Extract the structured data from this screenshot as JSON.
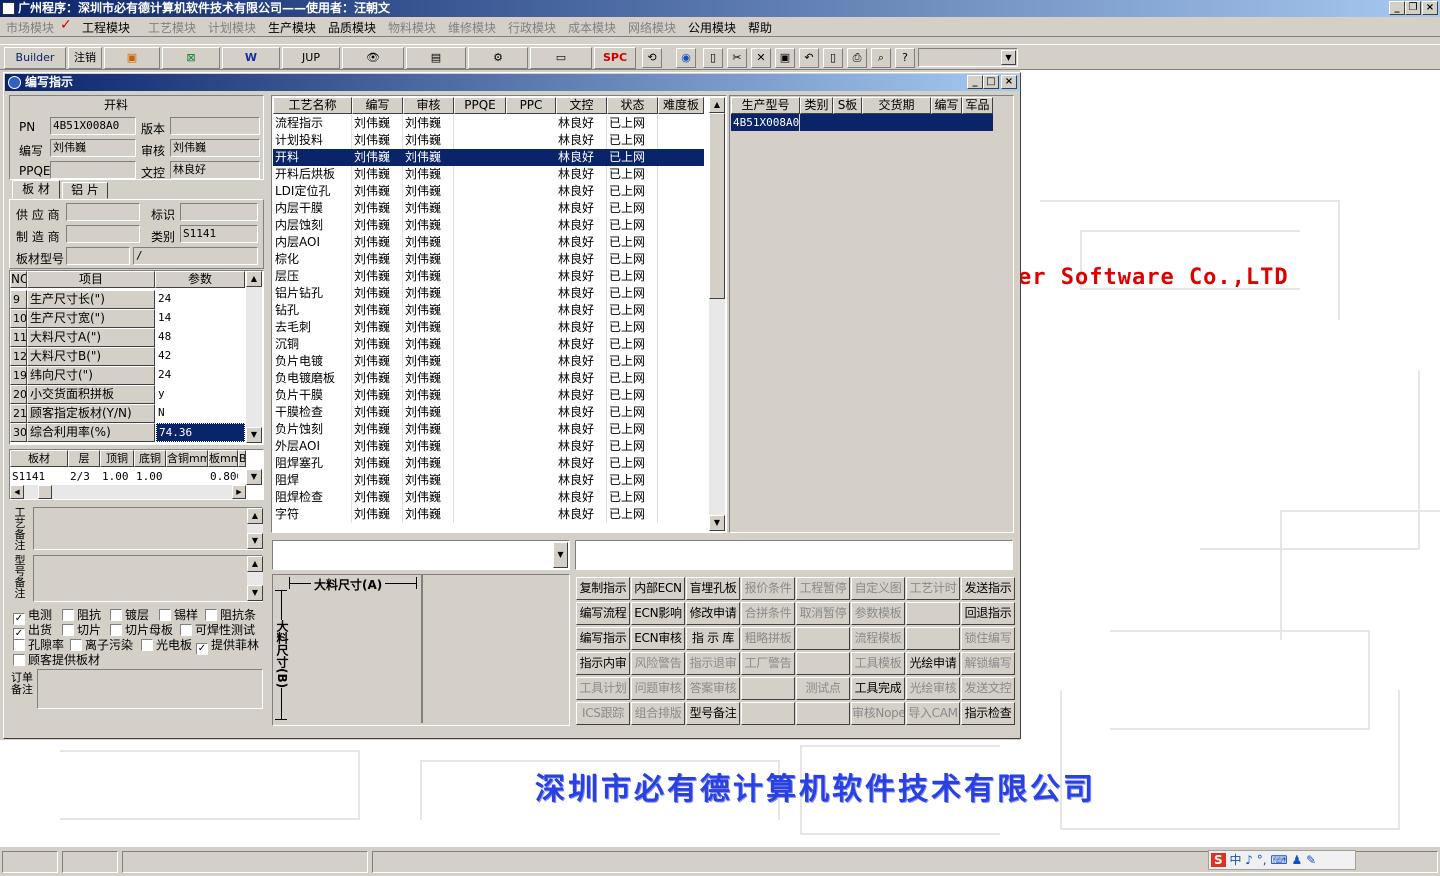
{
  "app": {
    "title": "广州程序：深圳市必有德计算机软件技术有限公司——使用者：汪朝文"
  },
  "menu": [
    {
      "label": "市场模块",
      "enabled": false
    },
    {
      "label": "✓",
      "enabled": true,
      "is_mark": true
    },
    {
      "label": "工程模块",
      "enabled": true
    },
    {
      "label": "工艺模块",
      "enabled": false
    },
    {
      "label": "计划模块",
      "enabled": false
    },
    {
      "label": "生产模块",
      "enabled": true
    },
    {
      "label": "品质模块",
      "enabled": true
    },
    {
      "label": "物料模块",
      "enabled": false
    },
    {
      "label": "维修模块",
      "enabled": false
    },
    {
      "label": "行政模块",
      "enabled": false
    },
    {
      "label": "成本模块",
      "enabled": false
    },
    {
      "label": "网络模块",
      "enabled": false
    },
    {
      "label": "公用模块",
      "enabled": true
    },
    {
      "label": "帮助",
      "enabled": true
    }
  ],
  "toolbar": {
    "builder": "Builder",
    "logout": "注销",
    "jup": "JUP",
    "spc": "SPC"
  },
  "child": {
    "title": "编写指示"
  },
  "head": {
    "section": "开料",
    "pn_label": "PN",
    "pn": "4B51X008A0",
    "version_label": "版本",
    "version": "",
    "writer_label": "编写",
    "writer": "刘伟巍",
    "reviewer_label": "审核",
    "reviewer": "刘伟巍",
    "ppqe_label": "PPQE",
    "ppqe": "",
    "docctl_label": "文控",
    "docctl": "林良好"
  },
  "tabs": [
    "板 材",
    "铝 片"
  ],
  "material": {
    "supplier_label": "供 应 商",
    "supplier": "",
    "mark_label": "标识",
    "mark": "",
    "maker_label": "制 造 商",
    "maker": "",
    "category_label": "类别",
    "category": "S1141",
    "model_label": "板材型号",
    "model": "",
    "model2": "/"
  },
  "params": {
    "headers": [
      "NO",
      "项目",
      "参数"
    ],
    "rows": [
      [
        "9",
        "生产尺寸长(\")",
        "24"
      ],
      [
        "10",
        "生产尺寸宽(\")",
        "14"
      ],
      [
        "11",
        "大料尺寸A(\")",
        "48"
      ],
      [
        "12",
        "大料尺寸B(\")",
        "42"
      ],
      [
        "19",
        "纬向尺寸(\")",
        "24"
      ],
      [
        "20",
        "小交货面积拼板",
        "y"
      ],
      [
        "21",
        "顾客指定板材(Y/N)",
        "N"
      ],
      [
        "30",
        "综合利用率(%)",
        "74.36"
      ]
    ]
  },
  "board": {
    "headers": [
      "板材",
      "层",
      "顶铜",
      "底铜",
      "含铜mm",
      "板mm",
      "B"
    ],
    "rows": [
      [
        "S1141",
        "2/3",
        "1.00",
        "1.00",
        "",
        "0.800"
      ]
    ]
  },
  "remarks": {
    "process_label": "工艺备注",
    "model_label": "型号备注",
    "order_label": "订单备注"
  },
  "checks": [
    {
      "label": "电测",
      "checked": true
    },
    {
      "label": "阻抗",
      "checked": false
    },
    {
      "label": "镀层",
      "checked": false
    },
    {
      "label": "锡样",
      "checked": false
    },
    {
      "label": "阻抗条",
      "checked": false
    },
    {
      "label": "出货",
      "checked": true
    },
    {
      "label": "切片",
      "checked": false
    },
    {
      "label": "切片母板",
      "checked": false
    },
    {
      "label": "可焊性测试",
      "checked": false
    },
    {
      "label": "孔隙率",
      "checked": false
    },
    {
      "label": "离子污染",
      "checked": false
    },
    {
      "label": "光电板",
      "checked": false
    },
    {
      "label": "提供菲林",
      "checked": true
    },
    {
      "label": "顾客提供板材",
      "checked": false
    }
  ],
  "process": {
    "headers": [
      "工艺名称",
      "编写",
      "审核",
      "PPQE",
      "PPC",
      "文控",
      "状态",
      "难度板"
    ],
    "rows": [
      [
        "流程指示",
        "刘伟巍",
        "刘伟巍",
        "",
        "",
        "林良好",
        "已上网"
      ],
      [
        "计划投料",
        "刘伟巍",
        "刘伟巍",
        "",
        "",
        "林良好",
        "已上网"
      ],
      [
        "开料",
        "刘伟巍",
        "刘伟巍",
        "",
        "",
        "林良好",
        "已上网"
      ],
      [
        "开料后烘板",
        "刘伟巍",
        "刘伟巍",
        "",
        "",
        "林良好",
        "已上网"
      ],
      [
        "LDI定位孔",
        "刘伟巍",
        "刘伟巍",
        "",
        "",
        "林良好",
        "已上网"
      ],
      [
        "内层干膜",
        "刘伟巍",
        "刘伟巍",
        "",
        "",
        "林良好",
        "已上网"
      ],
      [
        "内层蚀刻",
        "刘伟巍",
        "刘伟巍",
        "",
        "",
        "林良好",
        "已上网"
      ],
      [
        "内层AOI",
        "刘伟巍",
        "刘伟巍",
        "",
        "",
        "林良好",
        "已上网"
      ],
      [
        "棕化",
        "刘伟巍",
        "刘伟巍",
        "",
        "",
        "林良好",
        "已上网"
      ],
      [
        "层压",
        "刘伟巍",
        "刘伟巍",
        "",
        "",
        "林良好",
        "已上网"
      ],
      [
        "铝片钻孔",
        "刘伟巍",
        "刘伟巍",
        "",
        "",
        "林良好",
        "已上网"
      ],
      [
        "钻孔",
        "刘伟巍",
        "刘伟巍",
        "",
        "",
        "林良好",
        "已上网"
      ],
      [
        "去毛刺",
        "刘伟巍",
        "刘伟巍",
        "",
        "",
        "林良好",
        "已上网"
      ],
      [
        "沉铜",
        "刘伟巍",
        "刘伟巍",
        "",
        "",
        "林良好",
        "已上网"
      ],
      [
        "负片电镀",
        "刘伟巍",
        "刘伟巍",
        "",
        "",
        "林良好",
        "已上网"
      ],
      [
        "负电镀磨板",
        "刘伟巍",
        "刘伟巍",
        "",
        "",
        "林良好",
        "已上网"
      ],
      [
        "负片干膜",
        "刘伟巍",
        "刘伟巍",
        "",
        "",
        "林良好",
        "已上网"
      ],
      [
        "干膜检查",
        "刘伟巍",
        "刘伟巍",
        "",
        "",
        "林良好",
        "已上网"
      ],
      [
        "负片蚀刻",
        "刘伟巍",
        "刘伟巍",
        "",
        "",
        "林良好",
        "已上网"
      ],
      [
        "外层AOI",
        "刘伟巍",
        "刘伟巍",
        "",
        "",
        "林良好",
        "已上网"
      ],
      [
        "阻焊塞孔",
        "刘伟巍",
        "刘伟巍",
        "",
        "",
        "林良好",
        "已上网"
      ],
      [
        "阻焊",
        "刘伟巍",
        "刘伟巍",
        "",
        "",
        "林良好",
        "已上网"
      ],
      [
        "阻焊检查",
        "刘伟巍",
        "刘伟巍",
        "",
        "",
        "林良好",
        "已上网"
      ],
      [
        "字符",
        "刘伟巍",
        "刘伟巍",
        "",
        "",
        "林良好",
        "已上网"
      ]
    ]
  },
  "product": {
    "headers": [
      "生产型号",
      "类别",
      "S板",
      "交货期",
      "编写",
      "军品"
    ],
    "rows": [
      [
        "4B51X008A0",
        "",
        "",
        "",
        "",
        ""
      ]
    ]
  },
  "diagram": {
    "a_label": "大料尺寸(A)",
    "b_label": "大料尺寸(B)"
  },
  "actions": [
    [
      "复制指示",
      "内部ECN",
      "盲埋孔板",
      "报价条件",
      "工程暂停",
      "自定义图",
      "工艺计时",
      "发送指示"
    ],
    [
      "编写流程",
      "ECN影响",
      "修改申请",
      "合拼条件",
      "取消暂停",
      "参数模板",
      "",
      "回退指示"
    ],
    [
      "编写指示",
      "ECN审核",
      "指 示 库",
      "粗略拼板",
      "",
      "流程模板",
      "",
      "锁住编写"
    ],
    [
      "指示内审",
      "风险警告",
      "指示退审",
      "工厂警告",
      "",
      "工具模板",
      "光绘申请",
      "解锁编写"
    ],
    [
      "工具计划",
      "问题审核",
      "答案审核",
      "",
      "测试点",
      "工具完成",
      "光绘审核",
      "发送文控"
    ],
    [
      "ICS跟踪",
      "组合排版",
      "型号备注",
      "",
      "",
      "审核Nope",
      "导入CAM",
      "指示检查"
    ]
  ],
  "actions_enabled": [
    [
      1,
      1,
      1,
      0,
      0,
      0,
      0,
      1
    ],
    [
      1,
      1,
      1,
      0,
      0,
      0,
      0,
      1
    ],
    [
      1,
      1,
      1,
      0,
      0,
      0,
      0,
      0
    ],
    [
      1,
      0,
      0,
      0,
      0,
      0,
      1,
      0
    ],
    [
      0,
      0,
      0,
      0,
      0,
      1,
      0,
      0
    ],
    [
      0,
      0,
      1,
      0,
      0,
      0,
      0,
      1
    ]
  ],
  "brand": {
    "software": "er Software Co.,LTD",
    "company": "深圳市必有德计算机软件技术有限公司"
  },
  "ime": {
    "text": "中 ♪ °, ⌨ ♟ ✎"
  },
  "colors": {
    "title_start": "#0a246a",
    "title_end": "#a6caf0",
    "selection": "#0a246a",
    "face": "#d4d0c8",
    "brand_red": "#e00000",
    "brand_blue": "#2a40e0"
  }
}
